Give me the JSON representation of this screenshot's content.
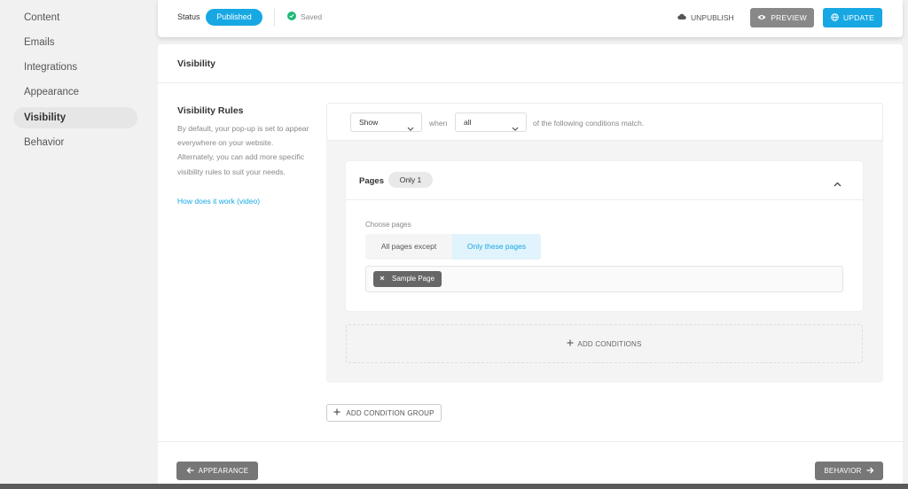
{
  "sidebar": {
    "items": [
      {
        "label": "Content"
      },
      {
        "label": "Emails"
      },
      {
        "label": "Integrations"
      },
      {
        "label": "Appearance"
      },
      {
        "label": "Visibility",
        "active": true
      },
      {
        "label": "Behavior"
      }
    ]
  },
  "topbar": {
    "status_label": "Status",
    "status_value": "Published",
    "saved_text": "Saved",
    "unpublish_label": "UNPUBLISH",
    "preview_label": "PREVIEW",
    "update_label": "UPDATE"
  },
  "panel": {
    "title": "Visibility",
    "rules_title": "Visibility Rules",
    "rules_description": "By default, your pop-up is set to appear everywhere on your website. Alternately, you can add more specific visibility rules to suit your needs.",
    "rules_link": "How does it work (video)",
    "condition_bar": {
      "show_select": "Show",
      "when_text": "when",
      "match_select": "all",
      "following_text": "of the following conditions match."
    },
    "pages_card": {
      "label": "Pages",
      "badge": "Only 1",
      "choose_label": "Choose pages",
      "option_except": "All pages except",
      "option_only": "Only these pages",
      "selected_pages": [
        "Sample Page"
      ]
    },
    "add_conditions_label": "ADD CONDITIONS",
    "add_group_label": "ADD CONDITION GROUP",
    "back_label": "APPEARANCE",
    "next_label": "BEHAVIOR"
  },
  "colors": {
    "accent": "#17a8e3",
    "success": "#1fb978",
    "neutral_button": "#888888"
  }
}
